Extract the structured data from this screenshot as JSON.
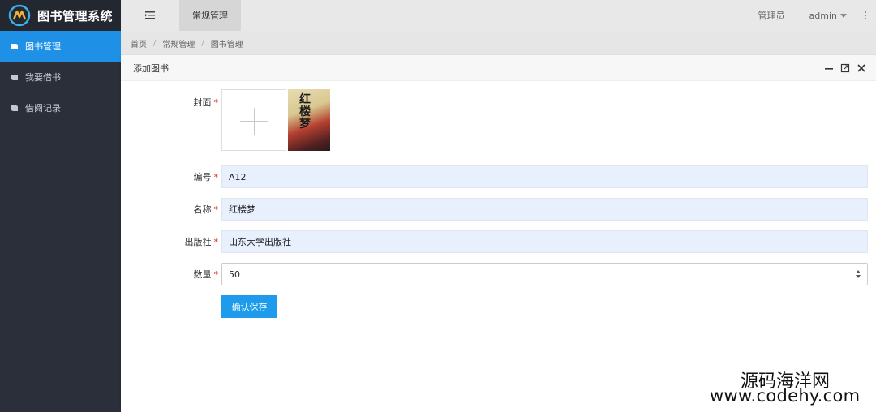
{
  "app": {
    "title": "图书管理系统"
  },
  "sidebar": {
    "items": [
      {
        "label": "图书管理",
        "icon": "book-icon",
        "active": true
      },
      {
        "label": "我要借书",
        "icon": "book-icon",
        "active": false
      },
      {
        "label": "借阅记录",
        "icon": "book-icon",
        "active": false
      }
    ]
  },
  "header": {
    "menu_icon": "menu-toggle-icon",
    "tab": "常规管理",
    "role": "管理员",
    "user": "admin"
  },
  "breadcrumb": [
    "首页",
    "常规管理",
    "图书管理"
  ],
  "dialog": {
    "title": "添加图书",
    "tools": [
      "minimize-icon",
      "maximize-icon",
      "close-icon"
    ]
  },
  "form": {
    "cover": {
      "label": "封面",
      "cover_text": "红楼梦"
    },
    "number": {
      "label": "编号",
      "value": "A12"
    },
    "name": {
      "label": "名称",
      "value": "红楼梦"
    },
    "publisher": {
      "label": "出版社",
      "value": "山东大学出版社"
    },
    "quantity": {
      "label": "数量",
      "value": "50"
    },
    "required_mark": "*",
    "submit_label": "确认保存"
  },
  "watermark": {
    "line1": "源码海洋网",
    "line2": "www.codehy.com"
  },
  "colors": {
    "accent": "#1e90e6",
    "sidebar_bg": "#2a2f3a",
    "button": "#1e9bea",
    "input_bg": "#e8f0fe"
  }
}
